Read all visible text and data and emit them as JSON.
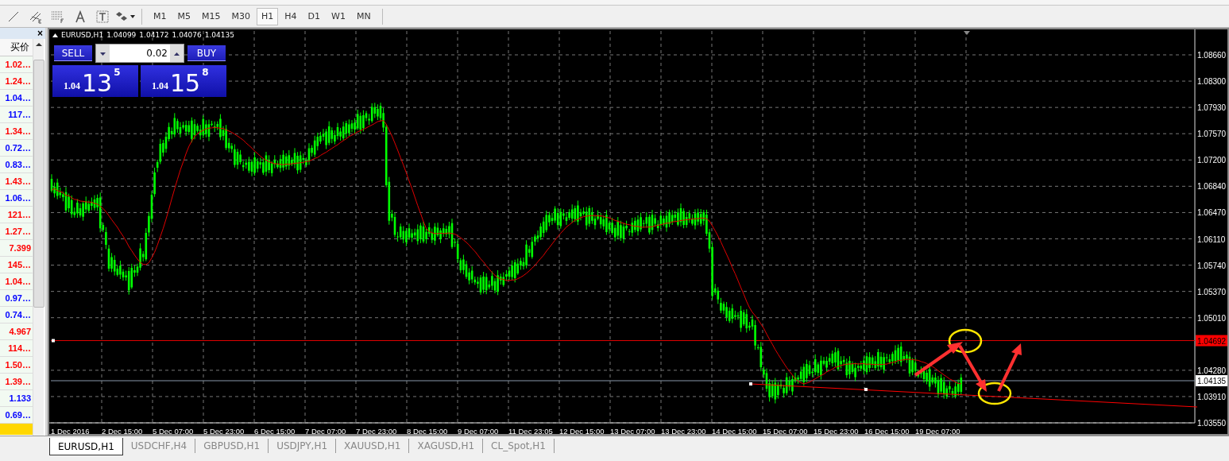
{
  "toolbar": {
    "timeframes": [
      {
        "label": "M1",
        "selected": false
      },
      {
        "label": "M5",
        "selected": false
      },
      {
        "label": "M15",
        "selected": false
      },
      {
        "label": "M30",
        "selected": false
      },
      {
        "label": "H1",
        "selected": true
      },
      {
        "label": "H4",
        "selected": false
      },
      {
        "label": "D1",
        "selected": false
      },
      {
        "label": "W1",
        "selected": false
      },
      {
        "label": "MN",
        "selected": false
      }
    ]
  },
  "market_watch": {
    "close": "×",
    "column": "买价",
    "rows": [
      {
        "bid": "1.02…",
        "color": "#ff0000"
      },
      {
        "bid": "1.24…",
        "color": "#ff0000"
      },
      {
        "bid": "1.04…",
        "color": "#0000ff"
      },
      {
        "bid": "117…",
        "color": "#0000ff"
      },
      {
        "bid": "1.34…",
        "color": "#ff0000"
      },
      {
        "bid": "0.72…",
        "color": "#0000ff"
      },
      {
        "bid": "0.83…",
        "color": "#0000ff"
      },
      {
        "bid": "1.43…",
        "color": "#ff0000"
      },
      {
        "bid": "1.06…",
        "color": "#0000ff"
      },
      {
        "bid": "121…",
        "color": "#ff0000"
      },
      {
        "bid": "1.27…",
        "color": "#ff0000"
      },
      {
        "bid": "7.399",
        "color": "#ff0000"
      },
      {
        "bid": "145…",
        "color": "#ff0000"
      },
      {
        "bid": "1.04…",
        "color": "#ff0000"
      },
      {
        "bid": "0.97…",
        "color": "#0000ff"
      },
      {
        "bid": "0.74…",
        "color": "#0000ff"
      },
      {
        "bid": "4.967",
        "color": "#ff0000"
      },
      {
        "bid": "114…",
        "color": "#ff0000"
      },
      {
        "bid": "1.50…",
        "color": "#ff0000"
      },
      {
        "bid": "1.39…",
        "color": "#ff0000"
      },
      {
        "bid": "1.133",
        "color": "#0000ff"
      },
      {
        "bid": "0.69…",
        "color": "#0000ff"
      }
    ]
  },
  "chart": {
    "symbol": "EURUSD,H1",
    "ohlc": [
      "1.04099",
      "1.04172",
      "1.04076",
      "1.04135"
    ],
    "trade_panel": {
      "sell": "SELL",
      "buy": "BUY",
      "lot": "0.02",
      "bid": {
        "prefix": "1.04",
        "big": "13",
        "small": "5"
      },
      "ask": {
        "prefix": "1.04",
        "big": "15",
        "small": "8"
      }
    },
    "price_axis": [
      "1.08660",
      "1.08300",
      "1.07930",
      "1.07570",
      "1.07200",
      "1.06840",
      "1.06470",
      "1.06110",
      "1.05740",
      "1.05370",
      "1.05010",
      "1.04280",
      "1.03910",
      "1.03550"
    ],
    "bid_badge": "1.04692",
    "last_badge": "1.04135",
    "time_axis": [
      "1 Dec 2016",
      "2 Dec 15:00",
      "5 Dec 07:00",
      "5 Dec 23:00",
      "6 Dec 15:00",
      "7 Dec 07:00",
      "7 Dec 23:00",
      "8 Dec 15:00",
      "9 Dec 07:00",
      "11 Dec 23:05",
      "12 Dec 15:00",
      "13 Dec 07:00",
      "13 Dec 23:00",
      "14 Dec 15:00",
      "15 Dec 07:00",
      "15 Dec 23:00",
      "16 Dec 15:00",
      "19 Dec 07:00"
    ]
  },
  "tabs": [
    {
      "label": "EURUSD,H1",
      "selected": true
    },
    {
      "label": "USDCHF,H4",
      "selected": false
    },
    {
      "label": "GBPUSD,H1",
      "selected": false
    },
    {
      "label": "USDJPY,H1",
      "selected": false
    },
    {
      "label": "XAUUSD,H1",
      "selected": false
    },
    {
      "label": "XAGUSD,H1",
      "selected": false
    },
    {
      "label": "CL_Spot,H1",
      "selected": false
    }
  ]
}
